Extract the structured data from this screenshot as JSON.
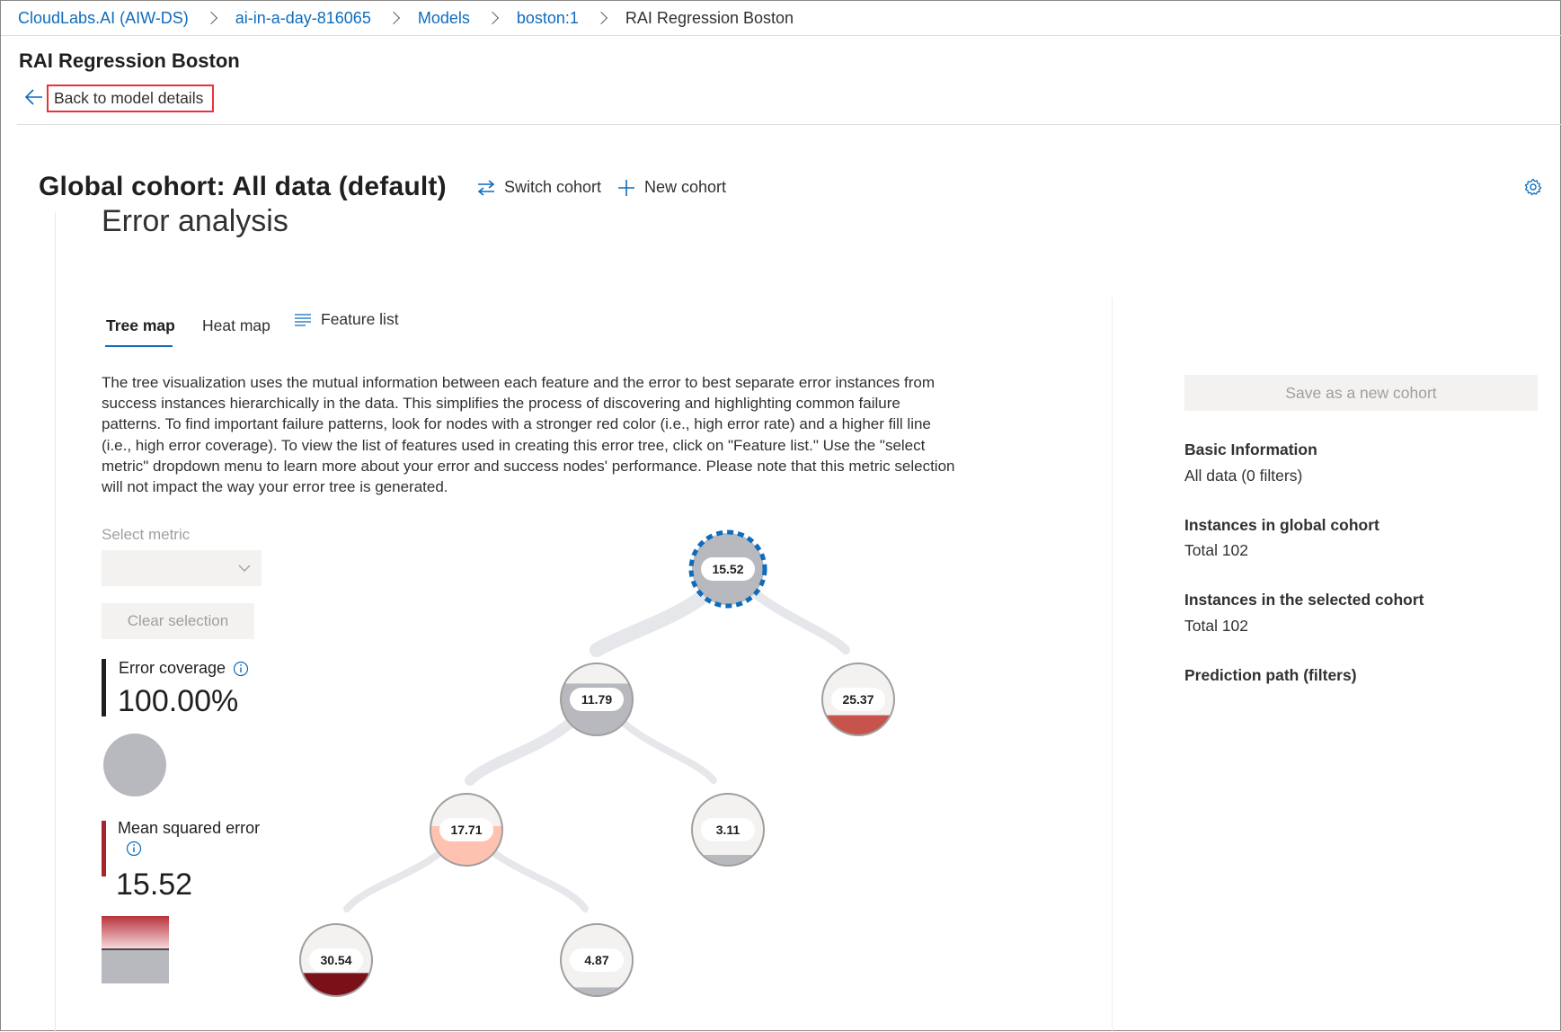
{
  "breadcrumb": {
    "items": [
      "CloudLabs.AI (AIW-DS)",
      "ai-in-a-day-816065",
      "Models",
      "boston:1"
    ],
    "current": "RAI Regression Boston"
  },
  "page": {
    "title": "RAI Regression Boston",
    "back_link": "Back to model details"
  },
  "cohort": {
    "title": "Global cohort: All data (default)",
    "switch_label": "Switch cohort",
    "new_label": "New cohort"
  },
  "section": {
    "title": "Error analysis"
  },
  "tabs": {
    "tree": "Tree map",
    "heat": "Heat map",
    "feature": "Feature list"
  },
  "description": "The tree visualization uses the mutual information between each feature and the error to best separate error instances from success instances hierarchically in the data. This simplifies the process of discovering and highlighting common failure patterns. To find important failure patterns, look for nodes with a stronger red color (i.e., high error rate) and a higher fill line (i.e., high error coverage). To view the list of features used in creating this error tree, click on \"Feature list.\" Use the \"select metric\" dropdown menu to learn more about your error and success nodes' performance. Please note that this metric selection will not impact the way your error tree is generated.",
  "controls": {
    "select_metric_label": "Select metric",
    "select_metric_value": "",
    "clear_selection": "Clear selection"
  },
  "metrics": {
    "error_coverage_label": "Error coverage",
    "error_coverage_value": "100.00%",
    "mse_label": "Mean squared error",
    "mse_value": "15.52"
  },
  "tree": {
    "nodes": [
      {
        "id": "root",
        "label": "15.52",
        "selected": true,
        "fill_color": "#b7b9be",
        "fill_level": 1.0
      },
      {
        "id": "l",
        "label": "11.79",
        "fill_color": "#b7b9be",
        "fill_level": 0.72
      },
      {
        "id": "r",
        "label": "25.37",
        "fill_color": "#c6544c",
        "fill_level": 0.28
      },
      {
        "id": "ll",
        "label": "17.71",
        "fill_color": "#ffc2b0",
        "fill_level": 0.55
      },
      {
        "id": "lr",
        "label": "3.11",
        "fill_color": "#b7b9be",
        "fill_level": 0.15
      },
      {
        "id": "lll",
        "label": "30.54",
        "fill_color": "#7a1118",
        "fill_level": 0.32
      },
      {
        "id": "llr",
        "label": "4.87",
        "fill_color": "#b7b9be",
        "fill_level": 0.12
      }
    ]
  },
  "side_panel": {
    "save_button": "Save as a new cohort",
    "basic_info_label": "Basic Information",
    "basic_info_value": "All data (0 filters)",
    "global_label": "Instances in global cohort",
    "global_value": "Total 102",
    "selected_label": "Instances in the selected cohort",
    "selected_value": "Total 102",
    "prediction_path_label": "Prediction path (filters)"
  },
  "colors": {
    "accent": "#0f6cbd",
    "highlight_border": "#e8333b",
    "error_red": "#a4262c",
    "disabled_bg": "#f3f2f1"
  }
}
